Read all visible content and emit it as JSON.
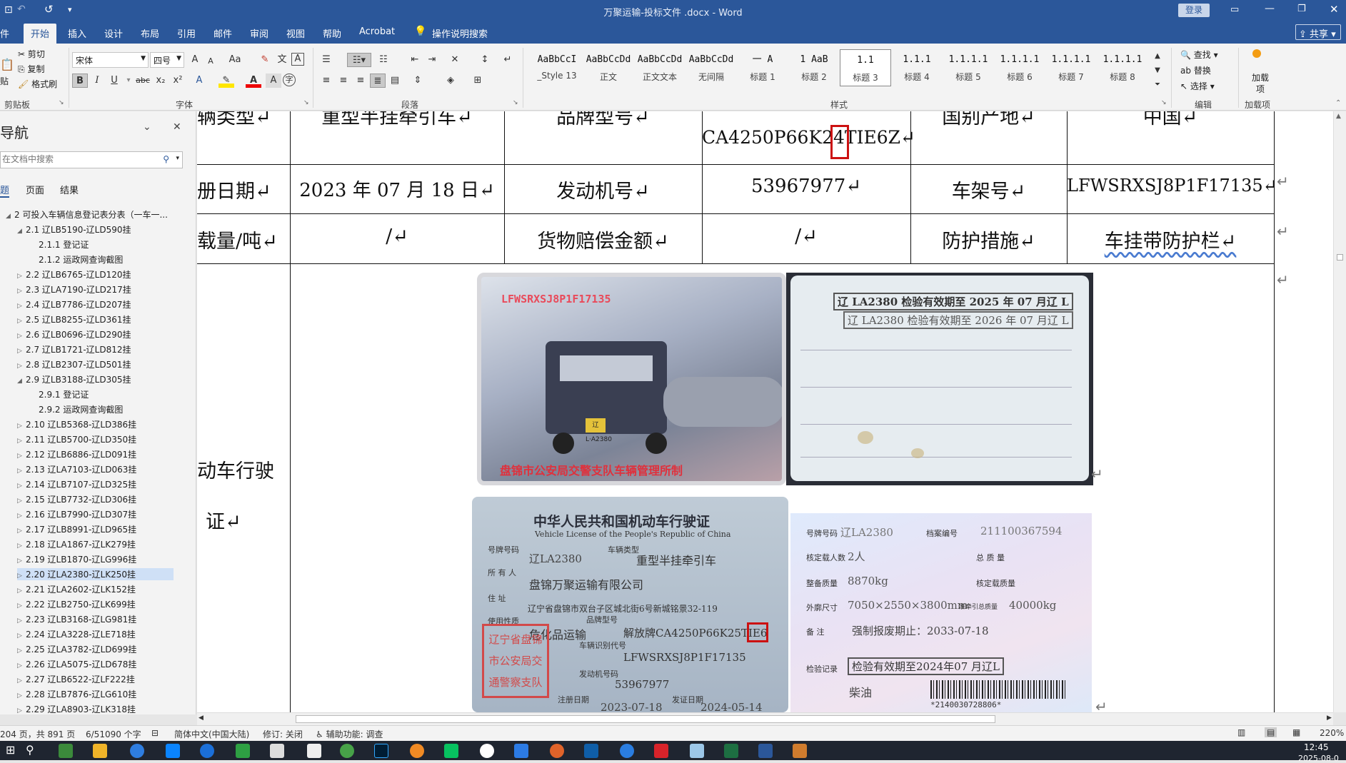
{
  "window": {
    "title": "万聚运输-投标文件 .docx - Word",
    "login": "登录",
    "share": "共享"
  },
  "quick_access": {
    "save": "⊡",
    "undo": "↶",
    "redo": "↺"
  },
  "tabs": [
    {
      "label": "件"
    },
    {
      "label": "开始"
    },
    {
      "label": "插入"
    },
    {
      "label": "设计"
    },
    {
      "label": "布局"
    },
    {
      "label": "引用"
    },
    {
      "label": "邮件"
    },
    {
      "label": "审阅"
    },
    {
      "label": "视图"
    },
    {
      "label": "帮助"
    },
    {
      "label": "Acrobat"
    },
    {
      "label": "操作说明搜索"
    }
  ],
  "ribbon": {
    "clipboard": {
      "cut": "剪切",
      "copy": "复制",
      "format_painter": "格式刷",
      "paste": "贴",
      "label": "剪贴板"
    },
    "font": {
      "name": "宋体",
      "size": "四号",
      "label": "字体",
      "grow": "A",
      "shrink": "A",
      "case": "Aa",
      "bold": "B",
      "italic": "I",
      "underline": "U",
      "strike": "abc",
      "sub": "x₂",
      "sup": "x²"
    },
    "paragraph": {
      "label": "段落"
    },
    "styles": {
      "label": "样式",
      "items": [
        {
          "preview": "AaBbCcI",
          "name": "_Style 13"
        },
        {
          "preview": "AaBbCcDd",
          "name": "正文"
        },
        {
          "preview": "AaBbCcDd",
          "name": "正文文本"
        },
        {
          "preview": "AaBbCcDd",
          "name": "无间隔"
        },
        {
          "preview": "一  A",
          "name": "标题 1"
        },
        {
          "preview": "1 AaB",
          "name": "标题 2"
        },
        {
          "preview": "1.1",
          "name": "标题 3"
        },
        {
          "preview": "1.1.1",
          "name": "标题 4"
        },
        {
          "preview": "1.1.1.1",
          "name": "标题 5"
        },
        {
          "preview": "1.1.1.1",
          "name": "标题 6"
        },
        {
          "preview": "1.1.1.1",
          "name": "标题 7"
        },
        {
          "preview": "1.1.1.1",
          "name": "标题 8"
        }
      ]
    },
    "editing": {
      "find": "查找",
      "replace": "替换",
      "select": "选择",
      "label": "编辑"
    },
    "addins": {
      "label": "加载项",
      "button": "加载项"
    }
  },
  "nav_pane": {
    "title": "导航",
    "search_placeholder": "在文档中搜索",
    "tabs": [
      "题",
      "页面",
      "结果"
    ],
    "items": [
      {
        "label": "2 可投入车辆信息登记表分表（一车一...",
        "level": 0,
        "toggle": "◢"
      },
      {
        "label": "2.1 辽LB5190-辽LD590挂",
        "level": 1,
        "toggle": "◢"
      },
      {
        "label": "2.1.1 登记证",
        "level": 2,
        "toggle": ""
      },
      {
        "label": "2.1.2 运政网查询截图",
        "level": 2,
        "toggle": ""
      },
      {
        "label": "2.2 辽LB6765-辽LD120挂",
        "level": 1,
        "toggle": "▷"
      },
      {
        "label": "2.3 辽LA7190-辽LD217挂",
        "level": 1,
        "toggle": "▷"
      },
      {
        "label": "2.4 辽LB7786-辽LD207挂",
        "level": 1,
        "toggle": "▷"
      },
      {
        "label": "2.5 辽LB8255-辽LD361挂",
        "level": 1,
        "toggle": "▷"
      },
      {
        "label": "2.6 辽LB0696-辽LD290挂",
        "level": 1,
        "toggle": "▷"
      },
      {
        "label": "2.7 辽LB1721-辽LD812挂",
        "level": 1,
        "toggle": "▷"
      },
      {
        "label": "2.8 辽LB2307-辽LD501挂",
        "level": 1,
        "toggle": "▷"
      },
      {
        "label": "2.9 辽LB3188-辽LD305挂",
        "level": 1,
        "toggle": "◢"
      },
      {
        "label": "2.9.1 登记证",
        "level": 2,
        "toggle": ""
      },
      {
        "label": "2.9.2 运政网查询截图",
        "level": 2,
        "toggle": ""
      },
      {
        "label": "2.10 辽LB5368-辽LD386挂",
        "level": 1,
        "toggle": "▷"
      },
      {
        "label": "2.11 辽LB5700-辽LD350挂",
        "level": 1,
        "toggle": "▷"
      },
      {
        "label": "2.12 辽LB6886-辽LD091挂",
        "level": 1,
        "toggle": "▷"
      },
      {
        "label": "2.13 辽LA7103-辽LD063挂",
        "level": 1,
        "toggle": "▷"
      },
      {
        "label": "2.14 辽LB7107-辽LD325挂",
        "level": 1,
        "toggle": "▷"
      },
      {
        "label": "2.15 辽LB7732-辽LD306挂",
        "level": 1,
        "toggle": "▷"
      },
      {
        "label": "2.16 辽LB7990-辽LD307挂",
        "level": 1,
        "toggle": "▷"
      },
      {
        "label": "2.17 辽LB8991-辽LD965挂",
        "level": 1,
        "toggle": "▷"
      },
      {
        "label": "2.18 辽LA1867-辽LK279挂",
        "level": 1,
        "toggle": "▷"
      },
      {
        "label": "2.19 辽LB1870-辽LG996挂",
        "level": 1,
        "toggle": "▷"
      },
      {
        "label": "2.20 辽LA2380-辽LK250挂",
        "level": 1,
        "toggle": "▷",
        "selected": true
      },
      {
        "label": "2.21 辽LA2602-辽LK152挂",
        "level": 1,
        "toggle": "▷"
      },
      {
        "label": "2.22 辽LB2750-辽LK699挂",
        "level": 1,
        "toggle": "▷"
      },
      {
        "label": "2.23 辽LB3168-辽LG981挂",
        "level": 1,
        "toggle": "▷"
      },
      {
        "label": "2.24 辽LA3228-辽LE718挂",
        "level": 1,
        "toggle": "▷"
      },
      {
        "label": "2.25 辽LA3782-辽LD699挂",
        "level": 1,
        "toggle": "▷"
      },
      {
        "label": "2.26 辽LA5075-辽LD678挂",
        "level": 1,
        "toggle": "▷"
      },
      {
        "label": "2.27 辽LB6522-辽LF222挂",
        "level": 1,
        "toggle": "▷"
      },
      {
        "label": "2.28 辽LB7876-辽LG610挂",
        "level": 1,
        "toggle": "▷"
      },
      {
        "label": "2.29 辽LA8903-辽LK318挂",
        "level": 1,
        "toggle": "▷"
      }
    ]
  },
  "document": {
    "row1": {
      "c1": "辆类型↵",
      "c2": "重型半挂牵引车↵",
      "c3": "品牌型号↵",
      "c4": "CA4250P66K24TIE6Z↵",
      "c5": "国别产地↵",
      "c6": "中国↵"
    },
    "row2": {
      "c1": "册日期↵",
      "c2": "2023 年 07 月 18 日↵",
      "c3": "发动机号↵",
      "c4": "53967977↵",
      "c5": "车架号↵",
      "c6": "LFWSRXSJ8P1F17135↵"
    },
    "row3": {
      "c1": "载量/吨↵",
      "c2": "/↵",
      "c3": "货物赔偿金额↵",
      "c4": "/↵",
      "c5": "防护措施↵",
      "c6": "车挂带防护栏↵"
    },
    "row4_label_a": "动车行驶",
    "row4_label_b": "证↵",
    "end_marks": [
      "↵",
      "↵",
      "↵"
    ],
    "photo1": {
      "top_text": "LFWSRXSJ8P1F17135",
      "bottom_text": "盘锦市公安局交警支队车辆管理所制",
      "plate": "辽L·A2380"
    },
    "photo2": {
      "stamp1": "辽 LA2380 检验有效期至 2025 年 07 月辽 L",
      "stamp2": "辽 LA2380 检验有效期至 2026 年 07 月辽 L"
    },
    "photo3": {
      "title_cn": "中华人民共和国机动车行驶证",
      "title_en": "Vehicle License of the People's Republic of China",
      "plate_label": "号牌号码",
      "plate": "辽LA2380",
      "type_label": "车辆类型",
      "type": "重型半挂牵引车",
      "owner_label": "所 有 人",
      "owner": "盘锦万聚运输有限公司",
      "addr_label": "住  址",
      "addr": "辽宁省盘锦市双台子区城北街6号新城铭景32-119",
      "use_label": "使用性质",
      "use": "危化品运输",
      "model_label": "品牌型号",
      "model": "解放牌CA4250P66K25TIE6",
      "vin_label": "车辆识别代号",
      "vin": "LFWSRXSJ8P1F17135",
      "engine_label": "发动机号码",
      "engine": "53967977",
      "reg_label": "注册日期",
      "reg": "2023-07-18",
      "issue_label": "发证日期",
      "issue": "2024-05-14",
      "seal_l1": "辽宁省盘锦",
      "seal_l2": "市公安局交",
      "seal_l3": "通警察支队"
    },
    "photo4": {
      "plate_label": "号牌号码",
      "plate": "辽LA2380",
      "file_label": "档案编号",
      "file": "211100367594",
      "cap_label": "核定载人数",
      "cap": "2人",
      "total_label": "总 质 量",
      "curb_label": "整备质量",
      "curb": "8870kg",
      "load_label": "核定载质量",
      "dim_label": "外廓尺寸",
      "dim": "7050×2550×3800mm",
      "tow_label": "准牵引总质量",
      "tow": "40000kg",
      "note_label": "备  注",
      "note": "强制报废期止：2033-07-18",
      "insp_label": "检验记录",
      "insp": "检验有效期至2024年07 月辽L",
      "fuel": "柴油",
      "barcode": "*2140030728806*"
    }
  },
  "statusbar": {
    "page": "204 页，共 891 页",
    "words": "6/51090 个字",
    "lang": "简体中文(中国大陆)",
    "track": "修订: 关闭",
    "access": "辅助功能: 调查",
    "zoom": "220%"
  },
  "taskbar": {
    "time": "12:45",
    "date": "2025-08-0"
  },
  "colors": {
    "word_blue": "#2b579a",
    "ribbon_bg": "#f3f3f3",
    "nav_select": "#cfe0f6",
    "red_box": "#cc1111"
  }
}
